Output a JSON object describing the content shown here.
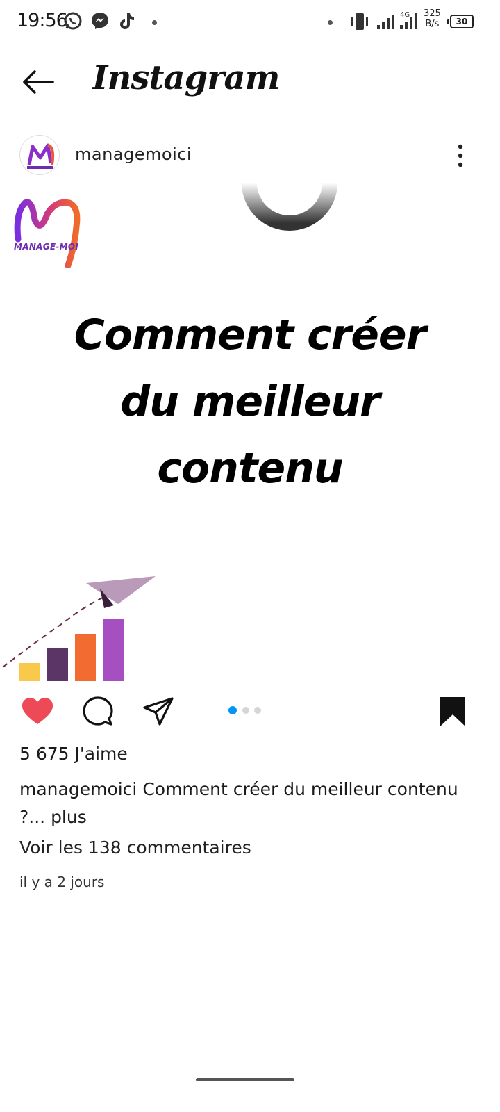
{
  "status_bar": {
    "time": "19:56",
    "net_speed_value": "325",
    "net_speed_unit": "B/s",
    "battery": "30",
    "network": "4G"
  },
  "header": {
    "title": "Instagram"
  },
  "post": {
    "username": "managemoici",
    "logo_text": "MANAGE-MOI",
    "headline_lines": [
      "Comment créer",
      "du meilleur",
      "contenu"
    ],
    "likes": "5 675 J'aime",
    "caption_username": "managemoici",
    "caption_text": "Comment créer du meilleur contenu ?...",
    "caption_more": "plus",
    "comments_link": "Voir les 138 commentaires",
    "time_ago": "il y a 2 jours",
    "carousel": {
      "total": 3,
      "active": 1
    }
  },
  "colors": {
    "like_red": "#ed4956",
    "carousel_active": "#0095f6",
    "bar_colors": [
      "#f8c94a",
      "#5b3565",
      "#f26b31",
      "#a64fc0"
    ],
    "plane": "#b99ab8"
  },
  "icons": {
    "back": "arrow-left-icon",
    "more": "more-vertical-icon",
    "like": "heart-icon",
    "comment": "comment-icon",
    "share": "paper-plane-icon",
    "save": "bookmark-icon"
  }
}
